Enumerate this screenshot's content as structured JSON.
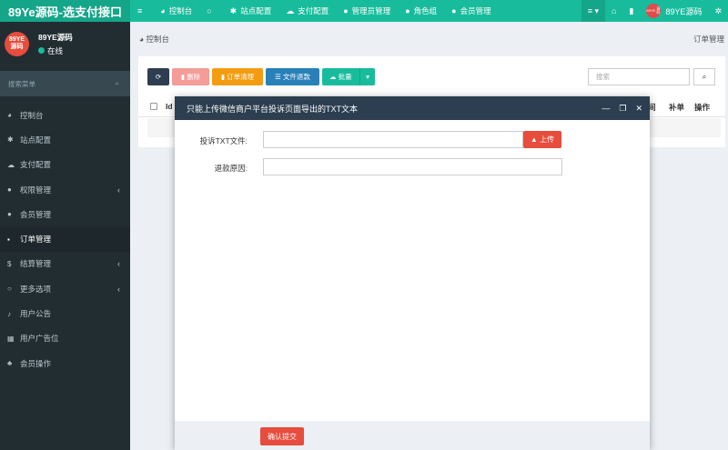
{
  "brand": "89Ye源码-选支付接口",
  "topnav": [
    {
      "icon": "≡",
      "label": ""
    },
    {
      "icon": "◕",
      "label": "控制台"
    },
    {
      "icon": "○",
      "label": ""
    },
    {
      "icon": "✱",
      "label": "站点配置"
    },
    {
      "icon": "☁",
      "label": "支付配置"
    },
    {
      "icon": "●",
      "label": "管理员管理"
    },
    {
      "icon": "●",
      "label": "角色组"
    },
    {
      "icon": "●",
      "label": "会员管理"
    }
  ],
  "topright": {
    "menu_icon": "≡ ▾",
    "home_icon": "⌂",
    "trash_icon": "▮",
    "avatar_line1": "89YE",
    "avatar_line2": "源码",
    "username": "89YE源码",
    "gear_icon": "✲"
  },
  "sidebar": {
    "avatar_line1": "89YE",
    "avatar_line2": "源码",
    "user_name": "89YE源码",
    "status": "在线",
    "search_placeholder": "搜索菜单",
    "search_icon": "⌕",
    "items": [
      {
        "icon": "◕",
        "label": "控制台",
        "chevron": ""
      },
      {
        "icon": "✱",
        "label": "站点配置",
        "chevron": ""
      },
      {
        "icon": "☁",
        "label": "支付配置",
        "chevron": ""
      },
      {
        "icon": "●",
        "label": "权限管理",
        "chevron": "‹"
      },
      {
        "icon": "●",
        "label": "会员管理",
        "chevron": ""
      },
      {
        "icon": "▪",
        "label": "订单管理",
        "chevron": ""
      },
      {
        "icon": "$",
        "label": "结算管理",
        "chevron": "‹"
      },
      {
        "icon": "○",
        "label": "更多选项",
        "chevron": "‹"
      },
      {
        "icon": "♪",
        "label": "用户公告",
        "chevron": ""
      },
      {
        "icon": "▦",
        "label": "用户广告位",
        "chevron": ""
      },
      {
        "icon": "♣",
        "label": "会员操作",
        "chevron": ""
      }
    ]
  },
  "breadcrumb": {
    "icon": "◕",
    "left": "控制台",
    "right": "订单管理"
  },
  "toolbar": {
    "refresh_icon": "⟳",
    "delete_label": "▮ 删除",
    "clean_label": "▮ 订单清理",
    "refund_label": "☰ 文件退款",
    "batch_label": "☁ 批量",
    "batch_caret": "▾"
  },
  "table_search": {
    "placeholder": "搜索",
    "icon": "⌕"
  },
  "table": {
    "col_id": "Id",
    "col_time": "间",
    "col_fix": "补单",
    "col_op": "操作"
  },
  "modal": {
    "title": "只能上传微信商户平台投诉页面导出的TXT文本",
    "minimize": "—",
    "maximize": "❐",
    "close": "✕",
    "file_label": "投诉TXT文件:",
    "upload_label": "▲ 上传",
    "reason_label": "退款原因:",
    "submit_label": "确认提交"
  }
}
